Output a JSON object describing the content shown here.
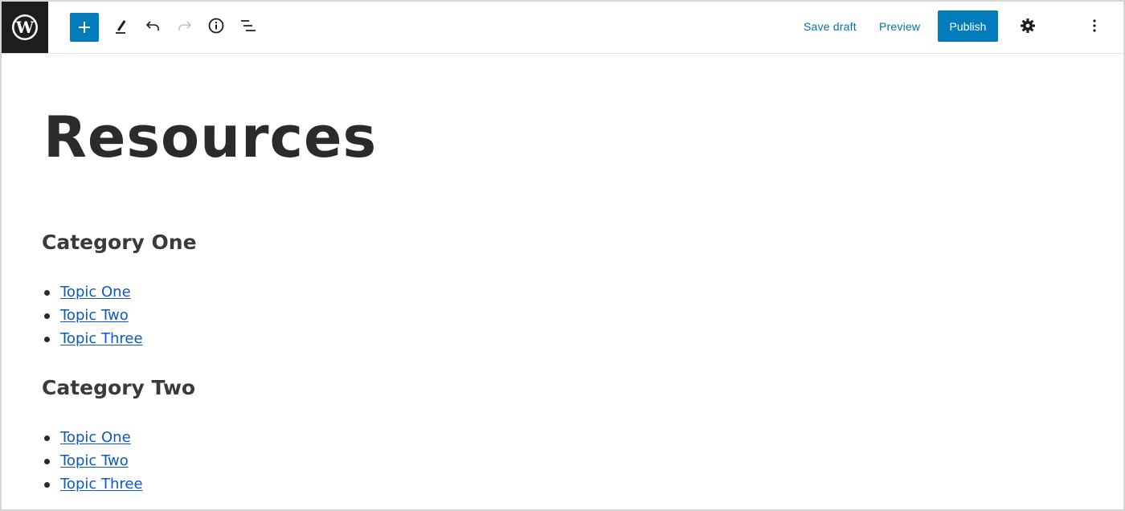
{
  "toolbar": {
    "save_draft_label": "Save draft",
    "preview_label": "Preview",
    "publish_label": "Publish"
  },
  "page": {
    "title": "Resources"
  },
  "categories": [
    {
      "heading": "Category One",
      "topics": [
        "Topic One",
        "Topic Two",
        "Topic Three"
      ]
    },
    {
      "heading": "Category Two",
      "topics": [
        "Topic One",
        "Topic Two",
        "Topic Three"
      ]
    }
  ],
  "colors": {
    "accent": "#007cba",
    "link": "#0a58ca",
    "logo_bg": "#1e1e1e"
  },
  "icons": [
    "wordpress-logo-icon",
    "plus-icon",
    "pencil-icon",
    "undo-icon",
    "redo-icon",
    "info-icon",
    "list-view-icon",
    "gear-icon",
    "more-vertical-icon"
  ]
}
